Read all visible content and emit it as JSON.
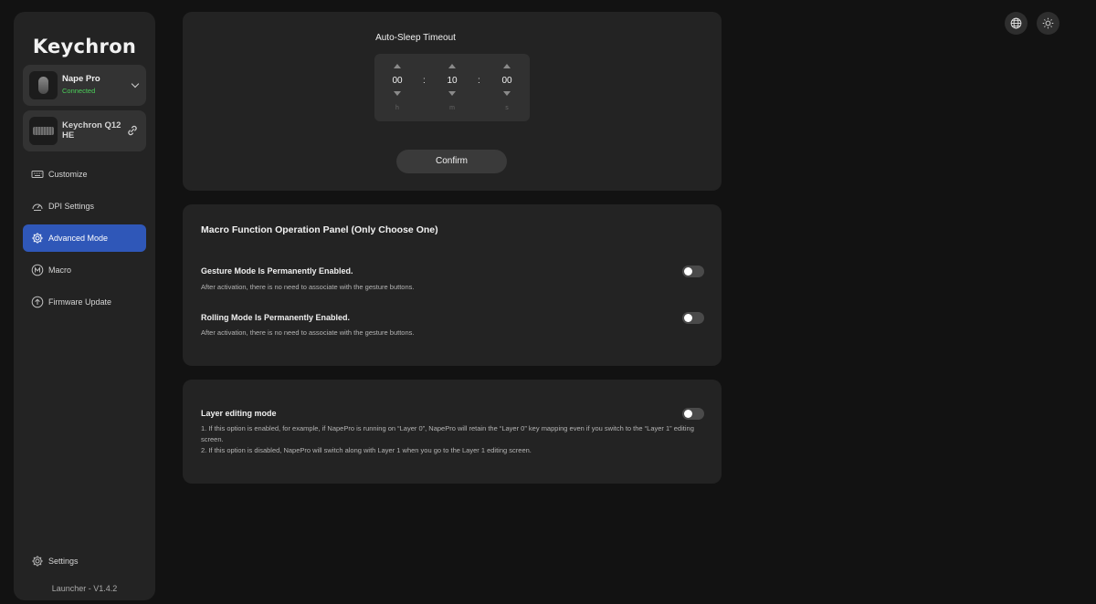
{
  "app": {
    "logo": "Keychron",
    "version": "Launcher - V1.4.2"
  },
  "devices": [
    {
      "name": "Nape Pro",
      "status": "Connected",
      "icon": "mouse-icon"
    },
    {
      "name": "Keychron Q12 HE",
      "icon": "keyboard-icon",
      "action_icon": "link-icon"
    }
  ],
  "nav": {
    "items": [
      {
        "label": "Customize",
        "icon": "keyboard-icon"
      },
      {
        "label": "DPI Settings",
        "icon": "gauge-icon"
      },
      {
        "label": "Advanced Mode",
        "icon": "gear-icon",
        "active": true
      },
      {
        "label": "Macro",
        "icon": "macro-icon"
      },
      {
        "label": "Firmware Update",
        "icon": "upload-icon"
      }
    ],
    "settings": {
      "label": "Settings",
      "icon": "gear-icon"
    }
  },
  "sleep": {
    "title": "Auto-Sleep Timeout",
    "hours": "00",
    "minutes": "10",
    "seconds": "00",
    "h_unit": "h",
    "m_unit": "m",
    "s_unit": "s",
    "confirm_label": "Confirm"
  },
  "macro_panel": {
    "title": "Macro Function Operation Panel (Only Choose One)",
    "gesture": {
      "title": "Gesture Mode Is Permanently Enabled.",
      "desc": "After activation, there is no need to associate with the gesture buttons.",
      "enabled": false
    },
    "rolling": {
      "title": "Rolling Mode Is Permanently Enabled.",
      "desc": "After activation, there is no need to associate with the gesture buttons.",
      "enabled": false
    }
  },
  "layer_panel": {
    "title": "Layer editing mode",
    "desc1": "1. If this option is enabled, for example, if NapePro is running on “Layer 0”, NapePro will retain the “Layer 0” key mapping even if you switch to the “Layer 1” editing screen.",
    "desc2": "2. If this option is disabled, NapePro will switch along with Layer 1 when you go to the Layer 1 editing screen.",
    "enabled": false
  },
  "top_actions": {
    "language_icon": "globe-icon",
    "theme_icon": "sun-icon"
  },
  "colors": {
    "accent": "#2f57b8",
    "connected": "#4ccf5a",
    "background": "#121212",
    "panel": "#232323"
  }
}
